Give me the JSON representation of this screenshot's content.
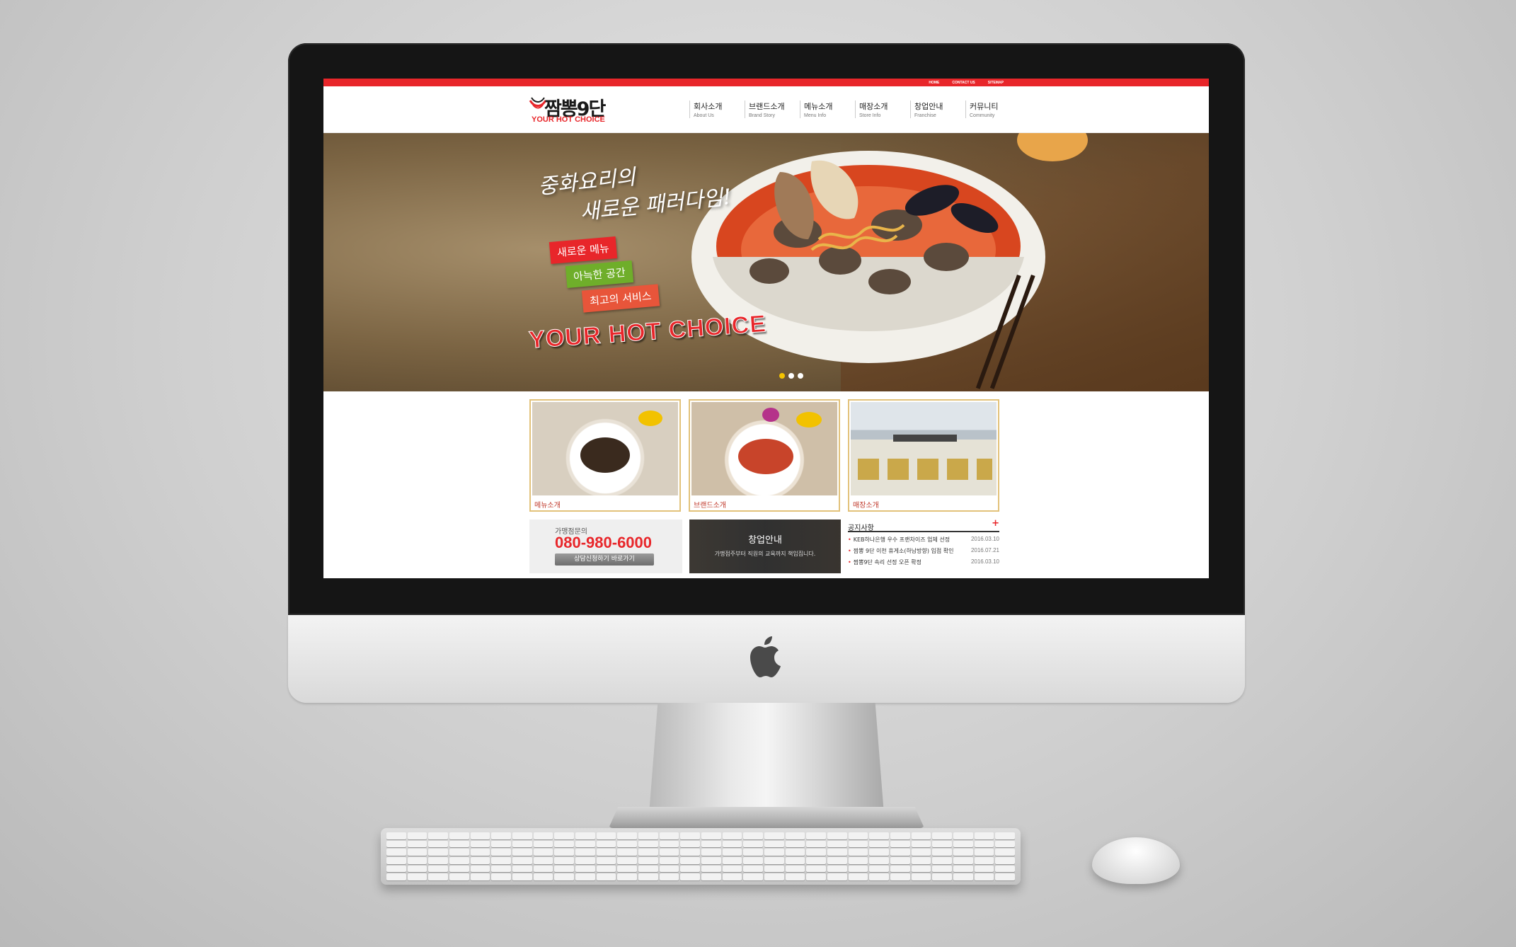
{
  "topbar": {
    "links": [
      "HOME",
      "CONTACT US",
      "SITEMAP"
    ]
  },
  "brand": {
    "name": "짬뽕9단",
    "tagline": "YOUR HOT CHOICE"
  },
  "nav": [
    {
      "ko": "회사소개",
      "en": "About Us"
    },
    {
      "ko": "브랜드소개",
      "en": "Brand Story"
    },
    {
      "ko": "메뉴소개",
      "en": "Menu Info"
    },
    {
      "ko": "매장소개",
      "en": "Store Info"
    },
    {
      "ko": "창업안내",
      "en": "Franchise"
    },
    {
      "ko": "커뮤니티",
      "en": "Community"
    }
  ],
  "hero": {
    "slogan_line1": "중화요리의",
    "slogan_line2": "새로운 패러다임!",
    "tags": [
      "새로운 메뉴",
      "아늑한 공간",
      "최고의 서비스"
    ],
    "brand_text": "YOUR HOT CHOICE",
    "slide_count": 3,
    "active_slide": 1
  },
  "cards": [
    {
      "label": "메뉴소개"
    },
    {
      "label": "브랜드소개"
    },
    {
      "label": "매장소개"
    }
  ],
  "contact": {
    "label": "가맹점문의",
    "phone": "080-980-6000",
    "button": "상담신청하기 바로가기"
  },
  "franchise": {
    "title": "창업안내",
    "desc": "가맹점주부터 직원의 교육까지 책임집니다."
  },
  "notice": {
    "title": "공지사항",
    "plus": "+",
    "items": [
      {
        "text": "KEB하나은행 우수 프랜차이즈 업체 선정",
        "date": "2016.03.10"
      },
      {
        "text": "짬뽕 9단 이천 휴게소(하남방향) 입점 확인",
        "date": "2016.07.21"
      },
      {
        "text": "짬뽕9단 속리 선정 오픈 확정",
        "date": "2016.03.10"
      }
    ]
  },
  "colors": {
    "brand_red": "#e8262a",
    "card_border": "#e2c27a",
    "tag_green": "#6fae2a"
  }
}
